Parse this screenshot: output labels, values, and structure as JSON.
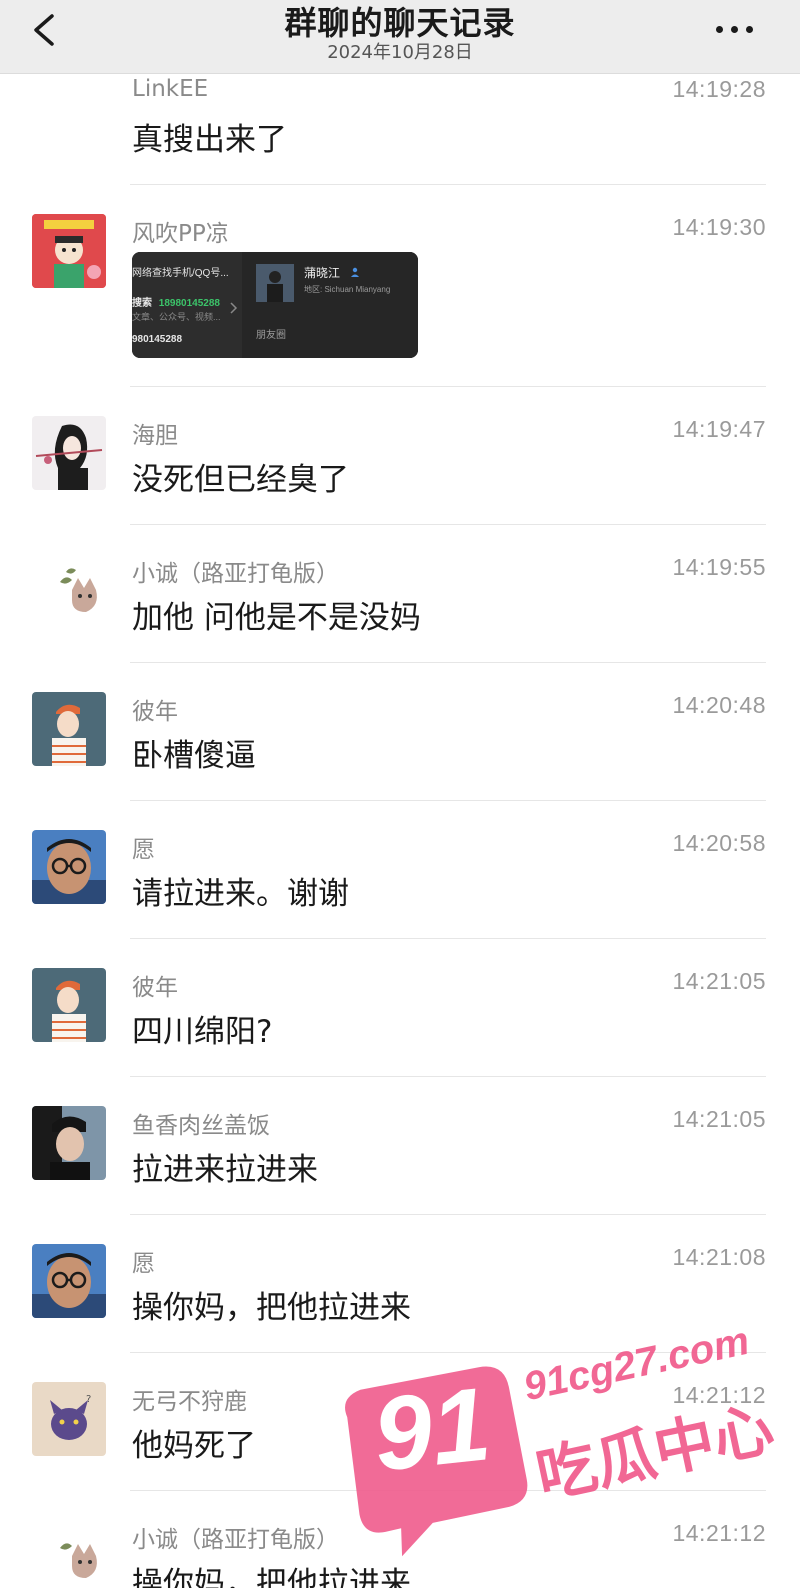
{
  "header": {
    "title": "群聊的聊天记录",
    "subtitle": "2024年10月28日"
  },
  "messages": [
    {
      "name": "LinkEE",
      "time": "14:19:28",
      "text": "真搜出来了"
    },
    {
      "name": "风吹PP凉",
      "time": "14:19:30",
      "text": ""
    },
    {
      "name": "海胆",
      "time": "14:19:47",
      "text": "没死但已经臭了"
    },
    {
      "name": "小诚（路亚打龟版）",
      "time": "14:19:55",
      "text": "加他 问他是不是没妈"
    },
    {
      "name": "彼年",
      "time": "14:20:48",
      "text": "卧槽傻逼"
    },
    {
      "name": "愿",
      "time": "14:20:58",
      "text": "请拉进来。谢谢"
    },
    {
      "name": "彼年",
      "time": "14:21:05",
      "text": "四川绵阳?"
    },
    {
      "name": "鱼香肉丝盖饭",
      "time": "14:21:05",
      "text": "拉进来拉进来"
    },
    {
      "name": "愿",
      "time": "14:21:08",
      "text": "操你妈，把他拉进来"
    },
    {
      "name": "无弓不狩鹿",
      "time": "14:21:12",
      "text": "他妈死了"
    },
    {
      "name": "小诚（路亚打龟版）",
      "time": "14:21:12",
      "text": "操你妈，把他拉进来"
    }
  ],
  "search_card": {
    "left_title": "网络查找手机/QQ号...",
    "search_label": "搜索",
    "search_number": "18980145288",
    "left_hint": "文章、公众号、视频...",
    "left_bottom": "980145288",
    "profile_name": "蒲晓江",
    "profile_region": "地区: Sichuan Mianyang",
    "moments_label": "朋友圈"
  },
  "watermark": {
    "number": "91",
    "url": "91cg27.com",
    "name": "吃瓜中心"
  },
  "colors": {
    "header_bg": "#ededed",
    "watermark_pink": "#f05b8c",
    "search_number_green": "#3cc46a"
  }
}
